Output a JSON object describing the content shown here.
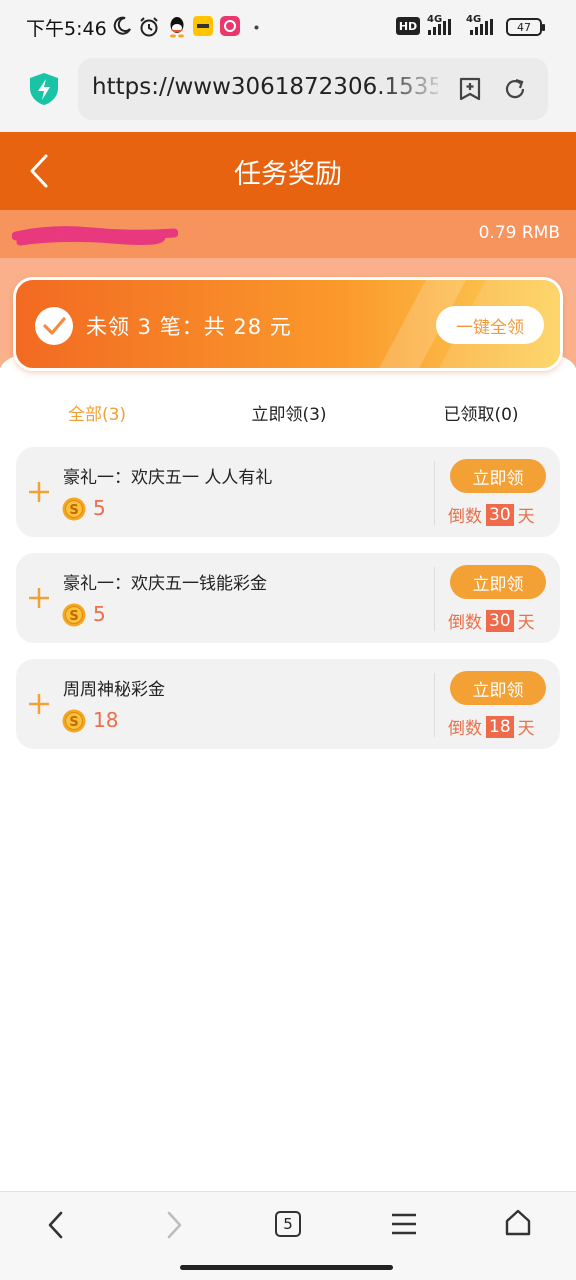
{
  "status_bar": {
    "time": "下午5:46",
    "network_1": "4G",
    "network_2": "4G",
    "hd_label": "HD",
    "battery": "47",
    "icons": [
      "moon-icon",
      "alarm-icon",
      "qq-icon",
      "meituan-icon",
      "app-icon",
      "dot-icon"
    ]
  },
  "browser": {
    "url": "https://www3061872306.1535",
    "tab_count": "5"
  },
  "header": {
    "title": "任务奖励"
  },
  "balance": {
    "text": "0.79 RMB"
  },
  "summary": {
    "text": "未领 3 笔：共 28 元",
    "claim_all_label": "一键全领"
  },
  "tabs": [
    {
      "label": "全部(3)",
      "active": true
    },
    {
      "label": "立即领(3)",
      "active": false
    },
    {
      "label": "已领取(0)",
      "active": false
    }
  ],
  "rewards": [
    {
      "name": "豪礼一：欢庆五一 人人有礼",
      "amount": "5",
      "button": "立即领",
      "countdown_prefix": "倒数",
      "days": "30",
      "countdown_suffix": "天"
    },
    {
      "name": "豪礼一：欢庆五一钱能彩金",
      "amount": "5",
      "button": "立即领",
      "countdown_prefix": "倒数",
      "days": "30",
      "countdown_suffix": "天"
    },
    {
      "name": "周周神秘彩金",
      "amount": "18",
      "button": "立即领",
      "countdown_prefix": "倒数",
      "days": "18",
      "countdown_suffix": "天"
    }
  ],
  "colors": {
    "header": "#e8630f",
    "accent": "#f3a035",
    "amount": "#e8704a",
    "days_badge": "#ee6a4a"
  }
}
